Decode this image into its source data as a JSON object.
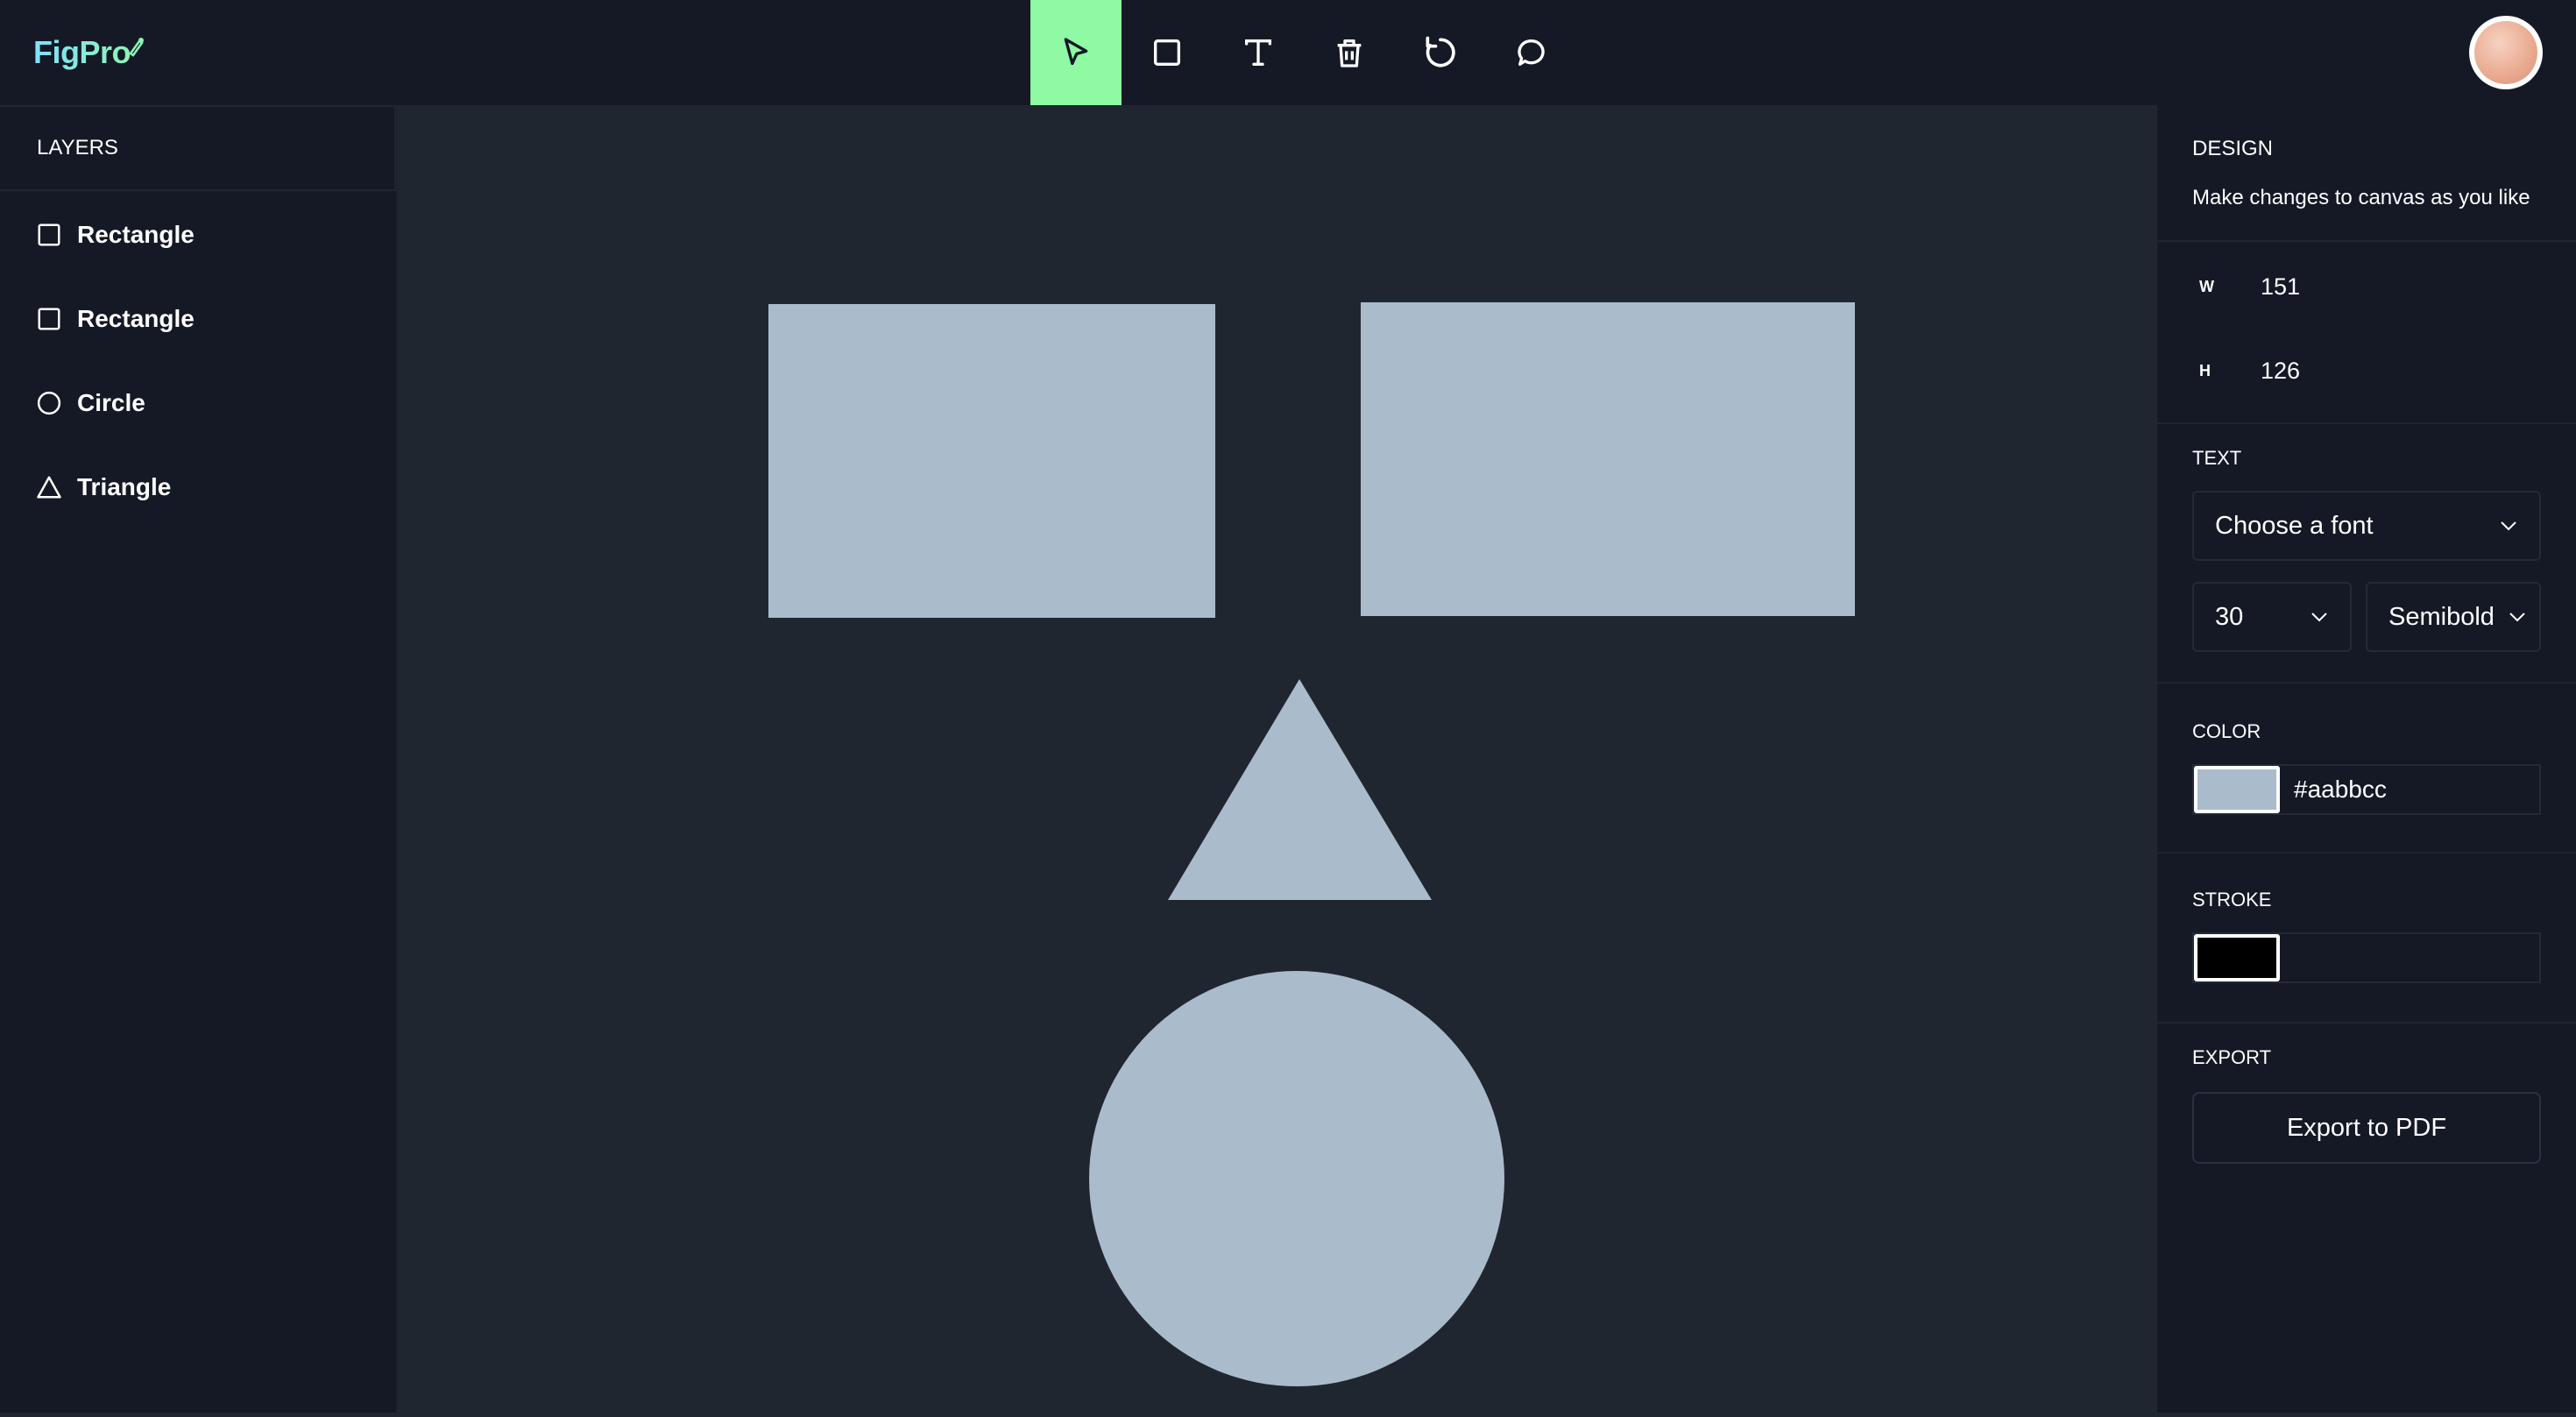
{
  "app": {
    "name": "FigPro"
  },
  "toolbar": {
    "tools": [
      {
        "name": "select-tool",
        "icon": "cursor-icon",
        "active": true
      },
      {
        "name": "rectangle-tool",
        "icon": "square-icon",
        "active": false
      },
      {
        "name": "text-tool",
        "icon": "text-icon",
        "active": false
      },
      {
        "name": "delete-tool",
        "icon": "trash-icon",
        "active": false
      },
      {
        "name": "reset-tool",
        "icon": "rotate-icon",
        "active": false
      },
      {
        "name": "comment-tool",
        "icon": "chat-icon",
        "active": false
      }
    ],
    "active_color": "#8ff9a4"
  },
  "layers": {
    "title": "LAYERS",
    "items": [
      {
        "label": "Rectangle",
        "icon": "square-icon"
      },
      {
        "label": "Rectangle",
        "icon": "square-icon"
      },
      {
        "label": "Circle",
        "icon": "circle-icon"
      },
      {
        "label": "Triangle",
        "icon": "triangle-icon"
      }
    ]
  },
  "canvas": {
    "background": "#20262f",
    "shape_fill": "#aabbcc"
  },
  "design": {
    "title": "DESIGN",
    "subtitle": "Make changes to canvas as you like",
    "width_label": "W",
    "width_value": "151",
    "height_label": "H",
    "height_value": "126",
    "text_title": "TEXT",
    "font_family": "Choose a font",
    "font_size": "30",
    "font_weight": "Semibold",
    "color_title": "COLOR",
    "color_value": "#aabbcc",
    "stroke_title": "STROKE",
    "stroke_color": "#000000",
    "export_title": "EXPORT",
    "export_button": "Export to PDF"
  }
}
